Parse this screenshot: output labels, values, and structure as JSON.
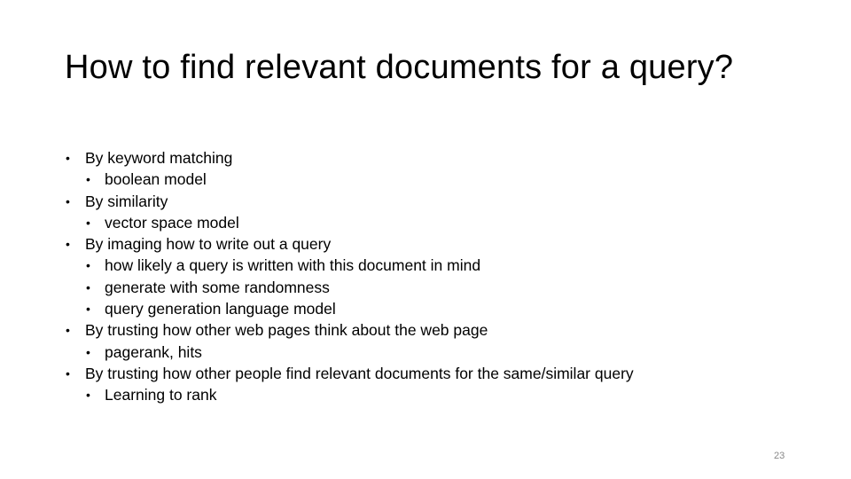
{
  "slide": {
    "title": "How to find relevant documents for a query?",
    "bullet_glyph": "•",
    "items": [
      {
        "level": 1,
        "text": "By keyword matching"
      },
      {
        "level": 2,
        "text": "boolean model"
      },
      {
        "level": 1,
        "text": "By similarity"
      },
      {
        "level": 2,
        "text": "vector space model"
      },
      {
        "level": 1,
        "text": "By imaging how to write out a query"
      },
      {
        "level": 2,
        "text": "how likely a query is written with this document in mind"
      },
      {
        "level": 2,
        "text": "generate with some randomness"
      },
      {
        "level": 2,
        "text": "query generation language model"
      },
      {
        "level": 1,
        "text": "By trusting how other web pages think about the web page"
      },
      {
        "level": 2,
        "text": "pagerank, hits"
      },
      {
        "level": 1,
        "text": "By trusting how other people find relevant documents for the same/similar query"
      },
      {
        "level": 2,
        "text": "Learning to rank"
      }
    ],
    "page_number": "23"
  }
}
